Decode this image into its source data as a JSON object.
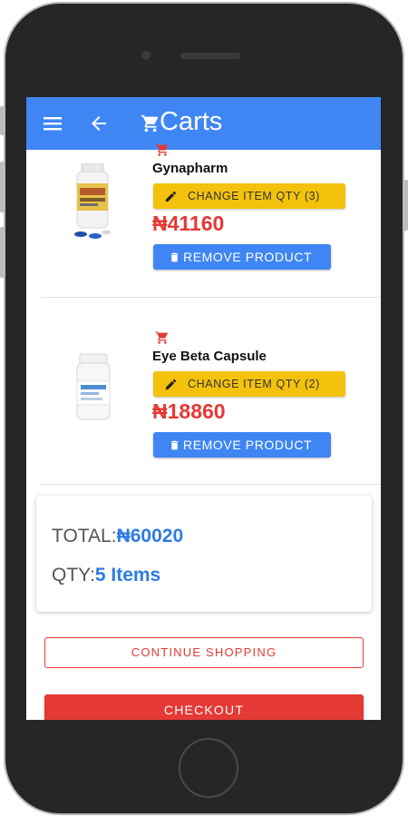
{
  "appbar": {
    "title": "Carts",
    "menu_icon": "menu-icon",
    "back_icon": "arrow-back-icon",
    "cart_icon": "cart-icon"
  },
  "cart": {
    "items": [
      {
        "name": "Gynapharm",
        "qty_button": "CHANGE ITEM QTY (3)",
        "price": "₦41160",
        "remove_button": "REMOVE PRODUCT"
      },
      {
        "name": "Eye Beta Capsule",
        "qty_button": "CHANGE ITEM QTY (2)",
        "price": "₦18860",
        "remove_button": "REMOVE PRODUCT"
      }
    ]
  },
  "summary": {
    "total_label": "TOTAL:",
    "total_value": "₦60020",
    "qty_label": "QTY:",
    "qty_value": "5 Items"
  },
  "actions": {
    "continue_label": "CONTINUE SHOPPING",
    "checkout_label": "CHECKOUT"
  },
  "colors": {
    "primary": "#3f86f4",
    "accent_yellow": "#f4c20d",
    "danger": "#e53935",
    "total_blue": "#2d7be5"
  }
}
